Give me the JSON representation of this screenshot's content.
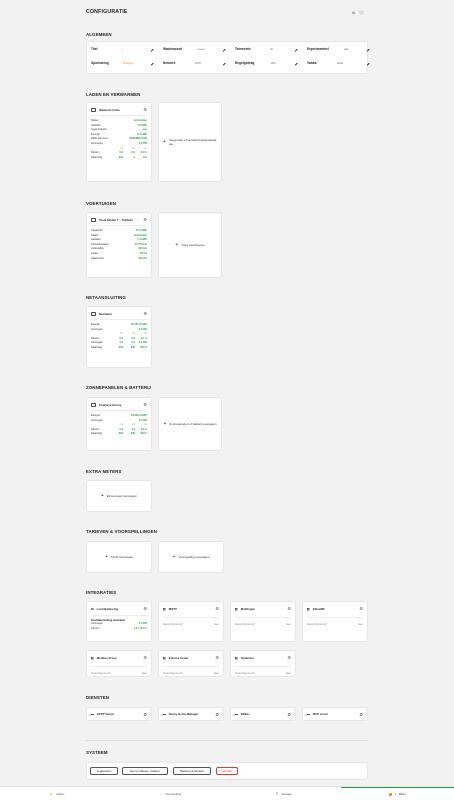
{
  "page_title": "CONFIGURATIE",
  "language": "NL",
  "sections": {
    "general": "ALGEMEEN",
    "charging": "LADEN EN VERWARMEN",
    "vehicles": "VOERTUIGEN",
    "grid": "NETAANSLUITING",
    "solar": "ZONNEPANELEN & BATTERIJ",
    "meters": "EXTRA METERS",
    "tariffs": "TARIEVEN & VOORSPELLINGEN",
    "integrations": "INTEGRATIES",
    "services": "DIENSTEN",
    "system": "SYSTEEM"
  },
  "general": [
    {
      "label": "Titel",
      "value": "---"
    },
    {
      "label": "Wachtwoord",
      "value": "••••••••"
    },
    {
      "label": "Telemetrie",
      "value": "uit"
    },
    {
      "label": "Experimenteel",
      "value": "aan"
    },
    {
      "label": "Sponsoring",
      "value": "8 dagen"
    },
    {
      "label": "Netwerk",
      "value": "7070"
    },
    {
      "label": "Regelgedrag",
      "value": "30s"
    },
    {
      "label": "Valuta",
      "value": "EUR"
    }
  ],
  "charger": {
    "name": "Webasto Unite",
    "rows": [
      [
        "Status",
        "verbonden"
      ],
      [
        "Geladen",
        "7,6 kWh"
      ],
      [
        "Ingeschakeld",
        "nee"
      ],
      [
        "Energie",
        "8,4 kWh"
      ],
      [
        "RFID-Nummer",
        "#EXEMPLAAR"
      ],
      [
        "Vermogen",
        "0,0 kW"
      ]
    ],
    "phase_headers": [
      "L1",
      "L2",
      "L3"
    ],
    "stroom": [
      "Stroom",
      "0,0",
      "0,0",
      "0,0 A"
    ],
    "spanning": [
      "Spanning",
      "233",
      "0",
      "0 V"
    ]
  },
  "charger_add": "Voeg lader of verwarmingsapparaat toe",
  "vehicle": {
    "name": "Tesla Model Y · Tuithchi",
    "rows": [
      [
        "Capaciteit",
        "57,5 kWh"
      ],
      [
        "Status",
        "verbonden"
      ],
      [
        "Geladen",
        "7,1 kWh"
      ],
      [
        "Kilometerstand",
        "44.776 km"
      ],
      [
        "Actieradius",
        "190 km"
      ],
      [
        "Laden",
        "78,1%"
      ],
      [
        "Laad-limiet",
        "100,0%"
      ]
    ]
  },
  "vehicle_add": "Voeg voertuig toe",
  "grid": {
    "name": "Netmeter",
    "rows": [
      [
        "Energie",
        "18.755,4 kWh"
      ],
      [
        "Vermogen",
        "0,6 kW"
      ]
    ],
    "phase_headers": [
      "L1",
      "L2",
      "L3"
    ],
    "stroom": [
      "Stroom",
      "0,2",
      "2,0",
      "0,1 A"
    ],
    "vermogen": [
      "Vermogen",
      "-1,2",
      "0,4",
      "-0,2 kW"
    ],
    "spanning": [
      "Spanning",
      "233",
      "230",
      "233 V"
    ]
  },
  "solar": {
    "name": "Enphase Envoy",
    "rows": [
      [
        "Energie",
        "13.399,4 kWh"
      ],
      [
        "Vermogen",
        "3,0 kW"
      ]
    ],
    "phase_headers": [
      "L1",
      "L2",
      "L3"
    ],
    "stroom": [
      "Stroom",
      "0,2",
      "4,9",
      "0,2 A"
    ],
    "spanning": [
      "Spanning",
      "233",
      "230",
      "233 V"
    ]
  },
  "solar_add": "Zonnepanelen of batterij toevoegen",
  "meter_add": "Extra meter toevoegen",
  "tariff_add": "Tarief toevoegen",
  "forecast_add": "Voorspelling toevoegen",
  "lb": {
    "name": "Load Balancing",
    "sub": "Hoofdaansluiting meterkast",
    "rows": [
      [
        "Vermogen",
        "2,5 kW"
      ],
      [
        "Stroom",
        "1,9 / 16,0 A"
      ]
    ]
  },
  "integrations": [
    {
      "name": "MQTT",
      "status": "Geconfigureerd",
      "val": "Nee"
    },
    {
      "name": "Meldingen",
      "status": "Geconfigureerd",
      "val": "Nee"
    },
    {
      "name": "InfluxDB",
      "status": "Geconfigureerd",
      "val": "Nee"
    },
    {
      "name": "Modbus Proxy",
      "status": "Geconfigureerd",
      "val": "Nee"
    },
    {
      "name": "Externe Sonel",
      "status": "Geconfigureerd",
      "val": "Nee"
    },
    {
      "name": "Optimizer",
      "status": "Geconfigureerd",
      "val": "Nee"
    }
  ],
  "services": [
    "OCPP Server",
    "Sunny Home Manager",
    "EEBus",
    "MCP server"
  ],
  "system_buttons": [
    "Logboeken",
    "Een probleem melden",
    "Backup & Herstel",
    "Herstart"
  ],
  "nav": [
    "Laden",
    "Voorspelling",
    "Sessies",
    "Meer"
  ],
  "colors": {
    "green": "#1ea43a",
    "orange": "#e8840c",
    "red": "#e33333"
  }
}
